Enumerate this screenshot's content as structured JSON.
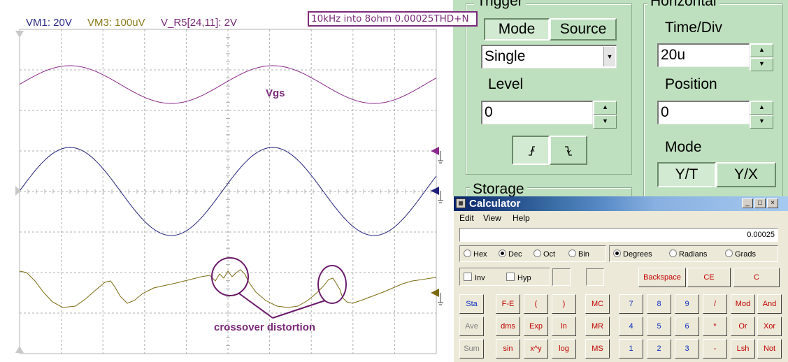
{
  "scope": {
    "channels": [
      {
        "label": "VM1: 20V",
        "color": "#2a2a8a"
      },
      {
        "label": "VM3: 100uV",
        "color": "#8a7a1a"
      },
      {
        "label": "V_R5[24,11]: 2V",
        "color": "#7a2a7a"
      }
    ],
    "annotation_box": "10kHz into 8ohm 0.00025THD+N",
    "vgs_label": "Vgs",
    "crossover_label": "crossover distortion",
    "colors": {
      "vgs": "#8a2a8a",
      "output": "#20207a",
      "distortion": "#7a6a10",
      "grid": "#b0b0b0"
    }
  },
  "trigger": {
    "title": "Trigger",
    "mode_label": "Mode",
    "source_label": "Source",
    "mode_value": "Single",
    "level_label": "Level",
    "level_value": "0",
    "rising_icon": "rising-edge-icon",
    "falling_icon": "falling-edge-icon"
  },
  "horizontal": {
    "title": "Horizontal",
    "timediv_label": "Time/Div",
    "timediv_value": "20u",
    "position_label": "Position",
    "position_value": "0",
    "mode_label": "Mode",
    "yt_label": "Y/T",
    "yx_label": "Y/X"
  },
  "storage": {
    "title": "Storage"
  },
  "calculator": {
    "title": "Calculator",
    "menu": [
      "Edit",
      "View",
      "Help"
    ],
    "display": "0.00025",
    "number_bases": [
      "Hex",
      "Dec",
      "Oct",
      "Bin"
    ],
    "angle_units": [
      "Degrees",
      "Radians",
      "Grads"
    ],
    "inv": "Inv",
    "hyp": "Hyp",
    "backspace": "Backspace",
    "ce": "CE",
    "c": "C",
    "rows": [
      [
        "Sta",
        "F-E",
        "(",
        ")",
        "MC",
        "7",
        "8",
        "9",
        "/",
        "Mod",
        "And"
      ],
      [
        "Ave",
        "dms",
        "Exp",
        "ln",
        "MR",
        "4",
        "5",
        "6",
        "*",
        "Or",
        "Xor"
      ],
      [
        "Sum",
        "sin",
        "x^y",
        "log",
        "MS",
        "1",
        "2",
        "3",
        "-",
        "Lsh",
        "Not"
      ]
    ]
  }
}
